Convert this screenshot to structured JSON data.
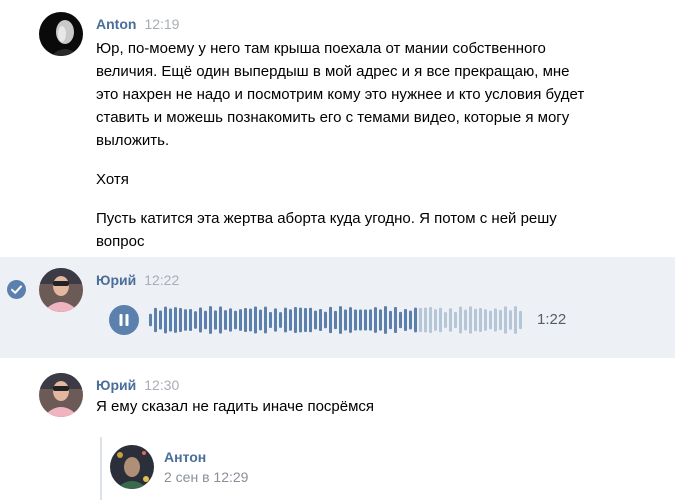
{
  "messages": [
    {
      "author": "Anton",
      "time": "12:19",
      "paragraphs": [
        "Юр, по-моему у него там крыша поехала от мании собственного величия. Ещё один выпердыш в мой адрес и я все прекращаю, мне это нахрен не надо и посмотрим кому это нужнее и кто условия будет ставить и можешь познакомить его с темами видео, которые я могу выложить.",
        "Хотя",
        "Пусть катится эта жертва аборта куда угодно. Я потом с ней решу вопрос"
      ]
    },
    {
      "author": "Юрий",
      "time": "12:22",
      "selected": true,
      "voice": {
        "duration": "1:22",
        "progress": 0.72,
        "state": "playing"
      }
    },
    {
      "author": "Юрий",
      "time": "12:30",
      "text": "Я ему сказал не гадить иначе посрёмся",
      "forwarded": {
        "author": "Антон",
        "date": "2 сен в 12:29"
      }
    }
  ],
  "colors": {
    "author": "#4a6e99",
    "selected_bg": "#edf0f5",
    "accent": "#5c80ad",
    "time": "#a9aeb5",
    "wave_played": "#5c80ad",
    "wave_unplayed": "#b6c6d9"
  },
  "icons": {
    "selected": "check-icon",
    "voice_control": "pause-icon"
  }
}
